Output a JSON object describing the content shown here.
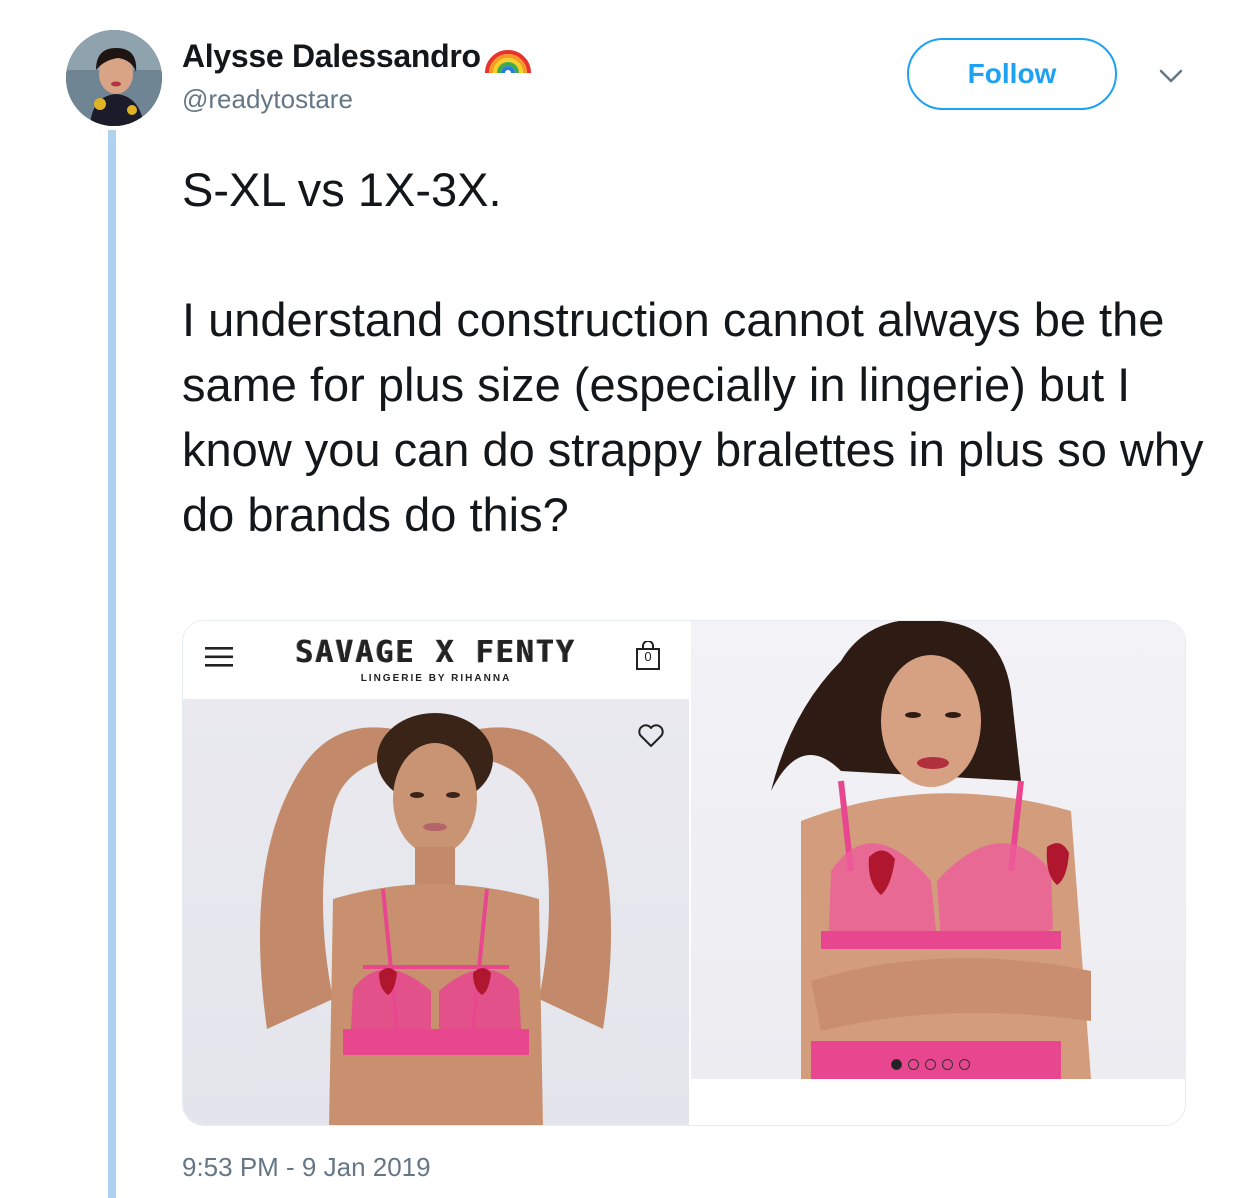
{
  "user": {
    "display_name": "Alysse Dalessandro",
    "handle": "@readytostare",
    "name_emoji": "rainbow-icon"
  },
  "actions": {
    "follow_label": "Follow",
    "more_icon": "chevron-down-icon"
  },
  "tweet": {
    "text": "S-XL vs 1X-3X.\n\nI understand construction cannot always be the same for plus size (especially in lingerie) but I know you can do strappy bralettes in plus so why do brands do this?",
    "timestamp": "9:53 PM - 9 Jan 2019"
  },
  "media": {
    "left": {
      "brand": "SAVAGE X FENTY",
      "brand_sub": "LINGERIE BY RIHANNA",
      "bag_count": "0",
      "icons": [
        "menu-icon",
        "shopping-bag-icon",
        "heart-icon"
      ]
    },
    "right": {
      "carousel_total": 5,
      "carousel_active": 1
    }
  },
  "colors": {
    "accent": "#1da1f2",
    "thread_line": "#aed3f0",
    "secondary_text": "#657786",
    "product_pink": "#e8468f"
  }
}
